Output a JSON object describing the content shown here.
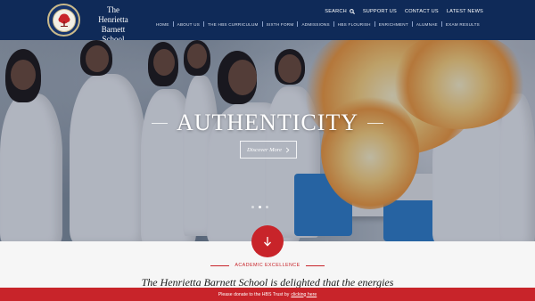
{
  "header": {
    "school_name_line1": "The",
    "school_name_line2": "Henrietta Barnett",
    "school_name_line3": "School",
    "logo_icon": "tree-crest-icon"
  },
  "top_nav": {
    "search_label": "SEARCH",
    "items": [
      "SUPPORT US",
      "CONTACT US",
      "LATEST NEWS"
    ]
  },
  "main_nav": {
    "items": [
      "HOME",
      "ABOUT US",
      "THE HBS CURRICULUM",
      "SIXTH FORM",
      "ADMISSIONS",
      "HBS FLOURISH",
      "ENRICHMENT",
      "ALUMNAE",
      "EXAM RESULTS"
    ]
  },
  "hero": {
    "title": "AUTHENTICITY",
    "button_label": "Discover More",
    "slides_count": 3,
    "active_slide": 1
  },
  "intro": {
    "kicker": "ACADEMIC EXCELLENCE",
    "text": "The Henrietta Barnett School is delighted that the energies"
  },
  "donate": {
    "text": "Please donate to the HBS Trust by",
    "link": "clicking here"
  },
  "colors": {
    "navy": "#0f2a58",
    "red": "#c8242a",
    "gold": "#c9b98a"
  }
}
